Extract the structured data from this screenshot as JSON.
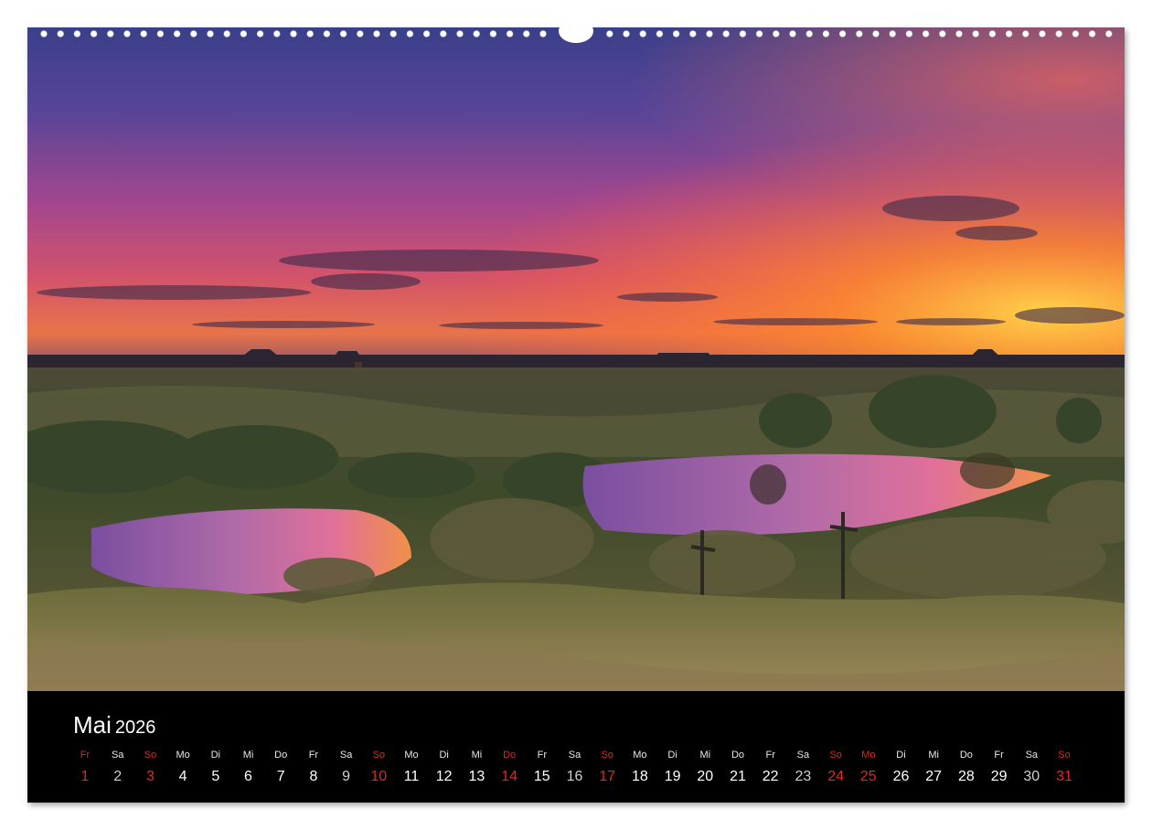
{
  "calendar": {
    "month": "Mai",
    "year": "2026",
    "days": [
      {
        "name": "Fr",
        "num": "1",
        "kind": "holiday"
      },
      {
        "name": "Sa",
        "num": "2",
        "kind": "sat"
      },
      {
        "name": "So",
        "num": "3",
        "kind": "holiday"
      },
      {
        "name": "Mo",
        "num": "4",
        "kind": "normal"
      },
      {
        "name": "Di",
        "num": "5",
        "kind": "normal"
      },
      {
        "name": "Mi",
        "num": "6",
        "kind": "normal"
      },
      {
        "name": "Do",
        "num": "7",
        "kind": "normal"
      },
      {
        "name": "Fr",
        "num": "8",
        "kind": "normal"
      },
      {
        "name": "Sa",
        "num": "9",
        "kind": "sat"
      },
      {
        "name": "So",
        "num": "10",
        "kind": "holiday"
      },
      {
        "name": "Mo",
        "num": "11",
        "kind": "normal"
      },
      {
        "name": "Di",
        "num": "12",
        "kind": "normal"
      },
      {
        "name": "Mi",
        "num": "13",
        "kind": "normal"
      },
      {
        "name": "Do",
        "num": "14",
        "kind": "holiday"
      },
      {
        "name": "Fr",
        "num": "15",
        "kind": "normal"
      },
      {
        "name": "Sa",
        "num": "16",
        "kind": "sat"
      },
      {
        "name": "So",
        "num": "17",
        "kind": "holiday"
      },
      {
        "name": "Mo",
        "num": "18",
        "kind": "normal"
      },
      {
        "name": "Di",
        "num": "19",
        "kind": "normal"
      },
      {
        "name": "Mi",
        "num": "20",
        "kind": "normal"
      },
      {
        "name": "Do",
        "num": "21",
        "kind": "normal"
      },
      {
        "name": "Fr",
        "num": "22",
        "kind": "normal"
      },
      {
        "name": "Sa",
        "num": "23",
        "kind": "sat"
      },
      {
        "name": "So",
        "num": "24",
        "kind": "holiday"
      },
      {
        "name": "Mo",
        "num": "25",
        "kind": "holiday"
      },
      {
        "name": "Di",
        "num": "26",
        "kind": "normal"
      },
      {
        "name": "Mi",
        "num": "27",
        "kind": "normal"
      },
      {
        "name": "Do",
        "num": "28",
        "kind": "normal"
      },
      {
        "name": "Fr",
        "num": "29",
        "kind": "normal"
      },
      {
        "name": "Sa",
        "num": "30",
        "kind": "sat"
      },
      {
        "name": "So",
        "num": "31",
        "kind": "holiday"
      }
    ]
  },
  "colors": {
    "holiday": "#e2271d",
    "strip_background": "#000000"
  },
  "photo": {
    "icon": "landscape-photo"
  }
}
